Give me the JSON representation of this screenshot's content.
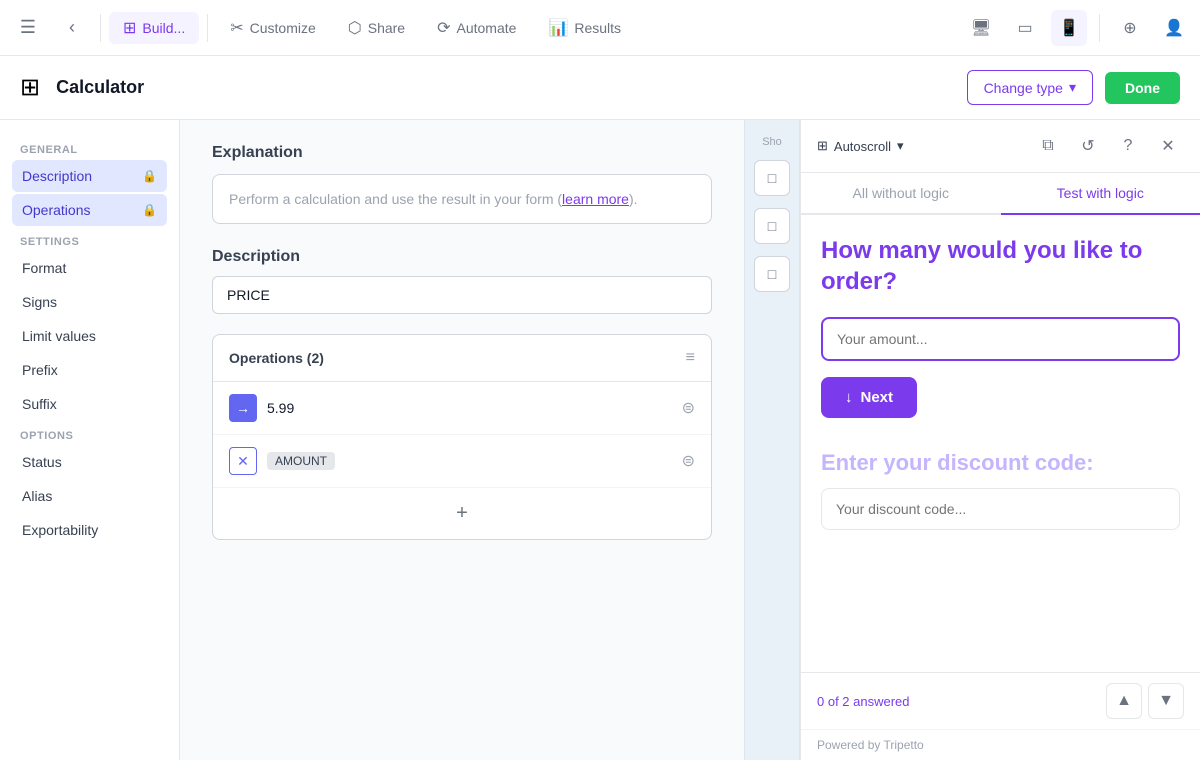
{
  "topNav": {
    "menuIcon": "☰",
    "backIcon": "‹",
    "buildLabel": "Build...",
    "buildIcon": "⊞",
    "settingsIcon": "⚙",
    "customizeLabel": "Customize",
    "customizeIcon": "✂",
    "shareLabel": "Share",
    "shareIcon": "⬡",
    "automateLabel": "Automate",
    "automateIcon": "⟳",
    "resultsLabel": "Results",
    "resultsIcon": "📊",
    "desktopIcon": "🖥",
    "tabletIcon": "▭",
    "mobileIcon": "📱",
    "globeIcon": "⊕",
    "personIcon": "👤"
  },
  "subHeader": {
    "calcLogoIcon": "⊞",
    "calcTitle": "Calculator",
    "changeTypeLabel": "Change type",
    "chevronIcon": "▾",
    "doneLabel": "Done"
  },
  "sidebar": {
    "generalLabel": "General",
    "descriptionItem": "Description",
    "operationsItem": "Operations",
    "settingsLabel": "Settings",
    "formatItem": "Format",
    "signsItem": "Signs",
    "limitValuesItem": "Limit values",
    "prefixItem": "Prefix",
    "suffixItem": "Suffix",
    "optionsLabel": "Options",
    "statusItem": "Status",
    "aliasItem": "Alias",
    "exportabilityItem": "Exportability"
  },
  "center": {
    "explanationTitle": "Explanation",
    "explanationText": "Perform a calculation and use the result in your form (",
    "explanationLink": "learn more",
    "explanationEnd": ").",
    "descriptionLabel": "Description",
    "descriptionValue": "PRICE",
    "operationsTitle": "Operations (2)",
    "operation1Value": "5.99",
    "operation2Tag": "AMOUNT",
    "addIcon": "+"
  },
  "rightPanel": {
    "autoscrollLabel": "Autoscroll",
    "chevronIcon": "▾",
    "copyIcon": "⧉",
    "refreshIcon": "↺",
    "helpIcon": "?",
    "closeIcon": "✕",
    "allWithoutLogicLabel": "All without logic",
    "testWithLogicLabel": "Test with logic",
    "questionText": "How many would you like to order?",
    "amountPlaceholder": "Your amount...",
    "nextLabel": "Next",
    "downArrowIcon": "↓",
    "discountLabel": "Enter your discount code:",
    "discountPlaceholder": "Your discount code...",
    "answeredText": "0 of 2 answered",
    "poweredByText": "Powered by Tripetto"
  },
  "middleDivider": {
    "showLabel": "Sho",
    "btn1": "□",
    "btn2": "□",
    "btn3": "□"
  },
  "colors": {
    "purple": "#7c3aed",
    "green": "#22c55e",
    "indigo": "#6366f1",
    "lightPurple": "#c4b5fd"
  }
}
